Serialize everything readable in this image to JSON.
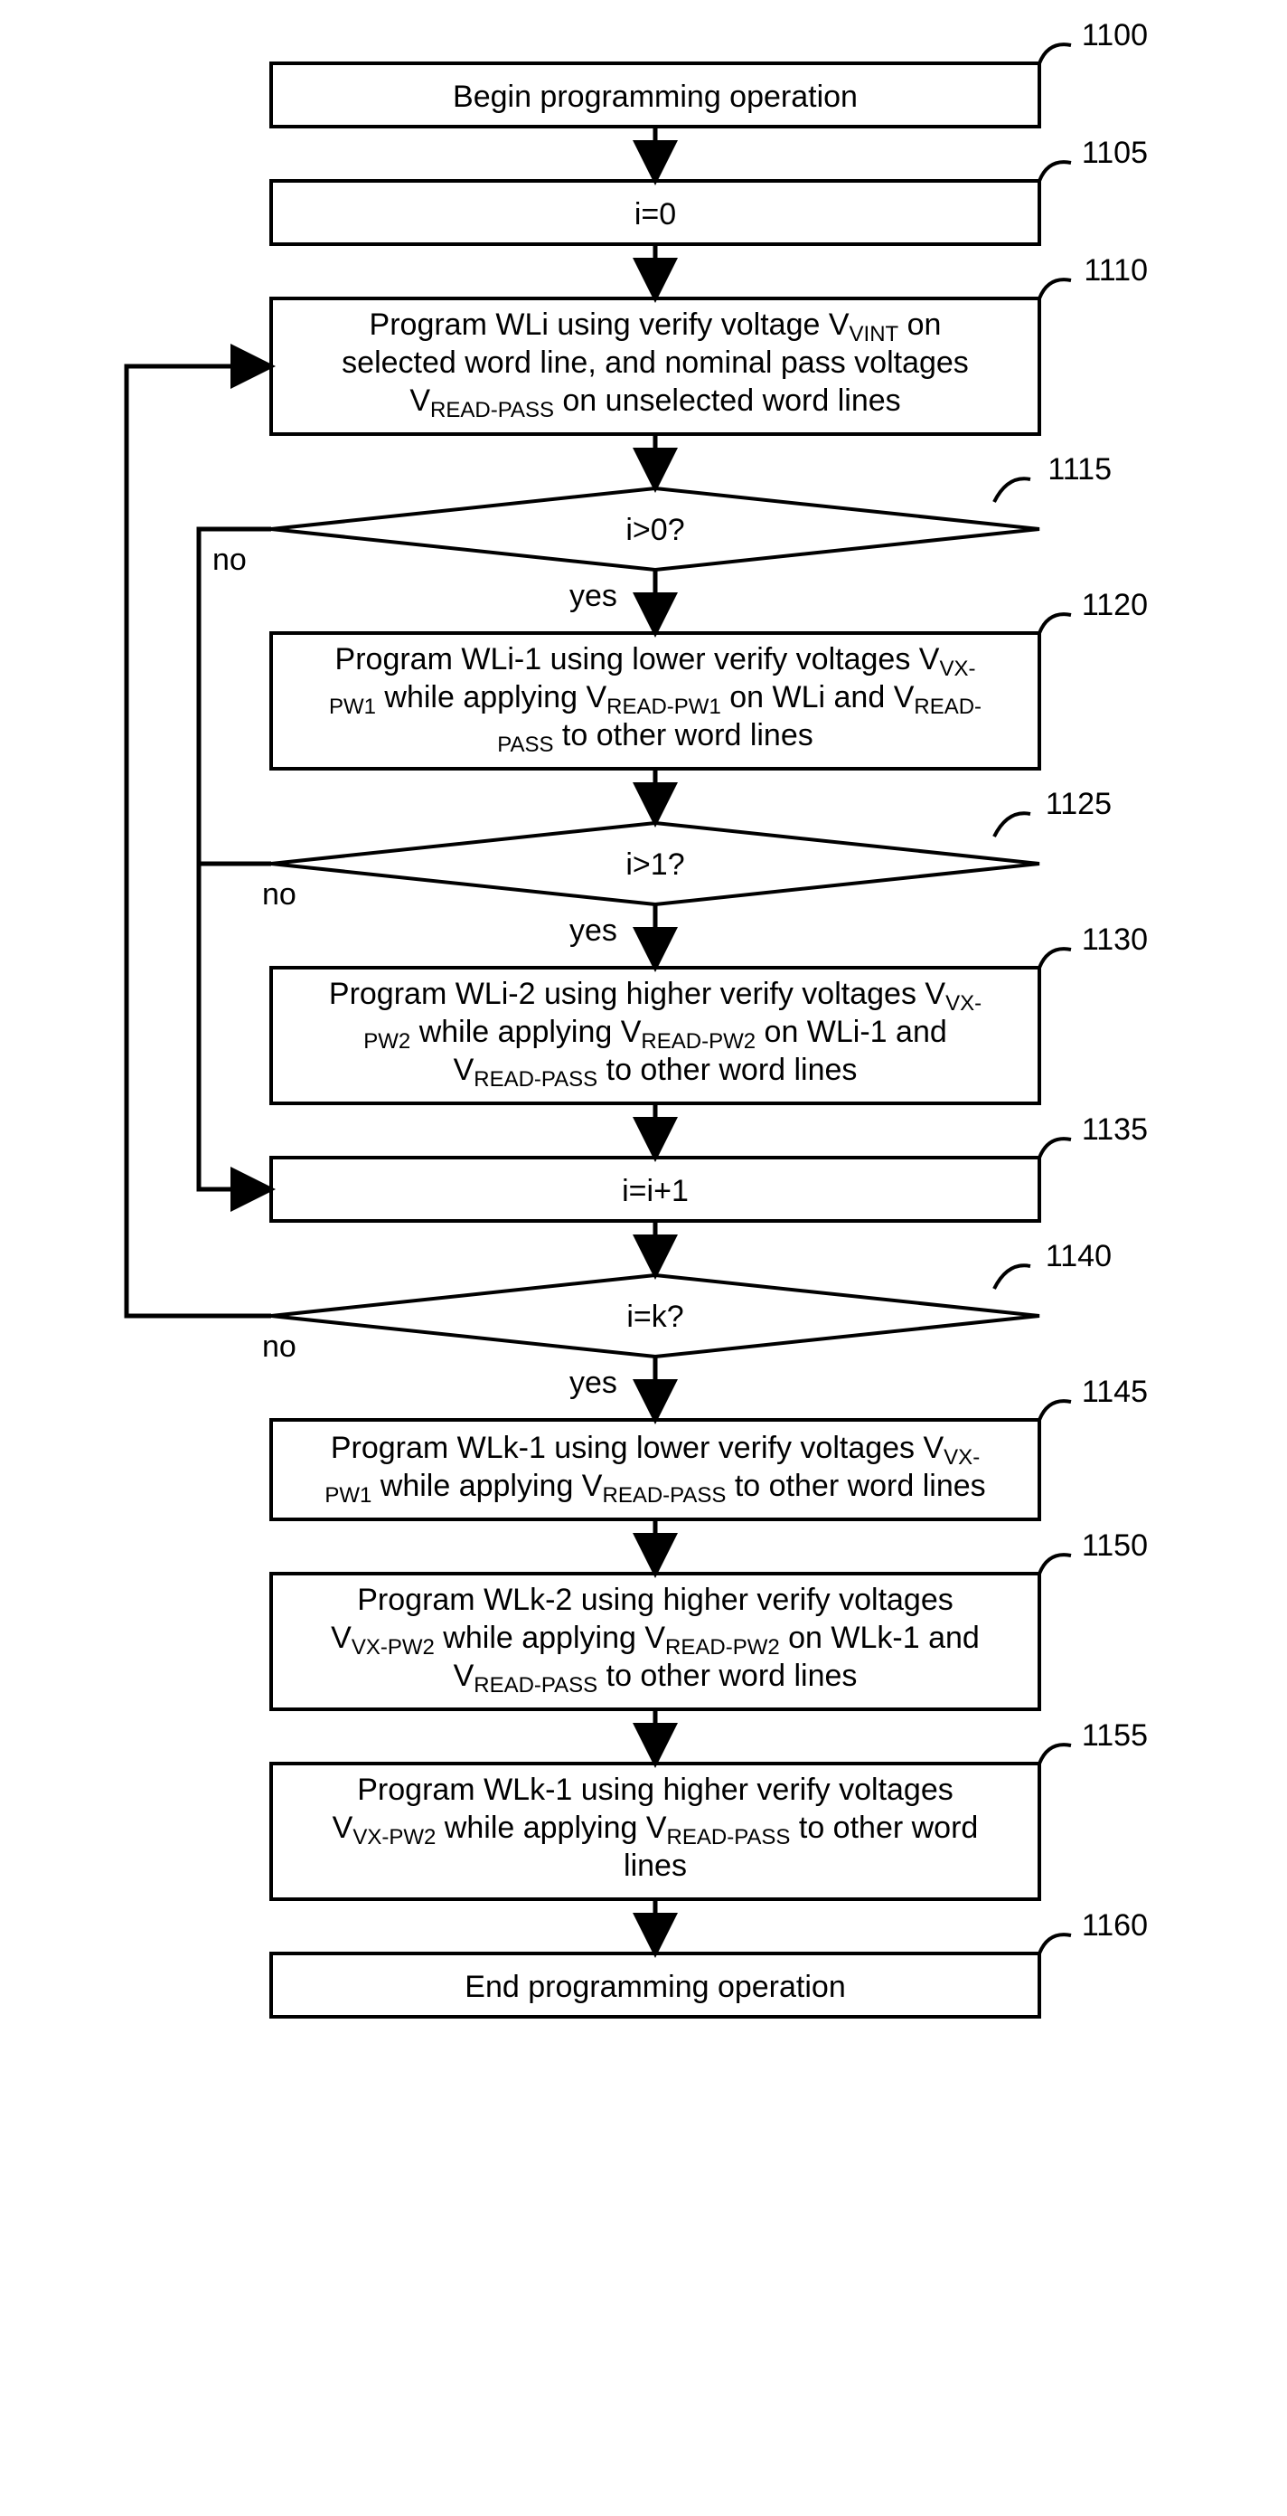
{
  "refs": {
    "r1100": "1100",
    "r1105": "1105",
    "r1110": "1110",
    "r1115": "1115",
    "r1120": "1120",
    "r1125": "1125",
    "r1130": "1130",
    "r1135": "1135",
    "r1140": "1140",
    "r1145": "1145",
    "r1150": "1150",
    "r1155": "1155",
    "r1160": "1160"
  },
  "labels": {
    "yes": "yes",
    "no": "no"
  },
  "nodes": {
    "n1100": "Begin programming operation",
    "n1105": "i=0",
    "n1110_l1a": "Program WLi using verify voltage V",
    "n1110_l1b": "VINT",
    "n1110_l1c": " on",
    "n1110_l2": "selected word line, and nominal pass voltages",
    "n1110_l3a": "V",
    "n1110_l3b": "READ-PASS",
    "n1110_l3c": " on unselected word lines",
    "n1115": "i>0?",
    "n1120_l1a": "Program WLi-1 using lower verify voltages V",
    "n1120_l1b": "VX-",
    "n1120_l2a": "PW1",
    "n1120_l2b": " while applying V",
    "n1120_l2c": "READ-PW1",
    "n1120_l2d": " on WLi and V",
    "n1120_l2e": "READ-",
    "n1120_l3a": "PASS",
    "n1120_l3b": " to other word lines",
    "n1125": "i>1?",
    "n1130_l1a": "Program WLi-2 using higher verify voltages V",
    "n1130_l1b": "VX-",
    "n1130_l2a": "PW2",
    "n1130_l2b": " while applying V",
    "n1130_l2c": "READ-PW2",
    "n1130_l2d": " on WLi-1 and",
    "n1130_l3a": "V",
    "n1130_l3b": "READ-PASS",
    "n1130_l3c": " to other word lines",
    "n1135": "i=i+1",
    "n1140": "i=k?",
    "n1145_l1a": "Program WLk-1 using lower verify voltages V",
    "n1145_l1b": "VX-",
    "n1145_l2a": "PW1",
    "n1145_l2b": " while applying V",
    "n1145_l2c": "READ-PASS",
    "n1145_l2d": " to other word lines",
    "n1150_l1": "Program WLk-2 using higher verify voltages",
    "n1150_l2a": "V",
    "n1150_l2b": "VX-PW2",
    "n1150_l2c": " while applying V",
    "n1150_l2d": "READ-PW2",
    "n1150_l2e": " on WLk-1 and",
    "n1150_l3a": "V",
    "n1150_l3b": "READ-PASS",
    "n1150_l3c": " to other word lines",
    "n1155_l1": "Program WLk-1 using higher verify voltages",
    "n1155_l2a": "V",
    "n1155_l2b": "VX-PW2",
    "n1155_l2c": " while applying V",
    "n1155_l2d": "READ-PASS",
    "n1155_l2e": " to other word",
    "n1155_l3": "lines",
    "n1160": "End programming operation"
  }
}
